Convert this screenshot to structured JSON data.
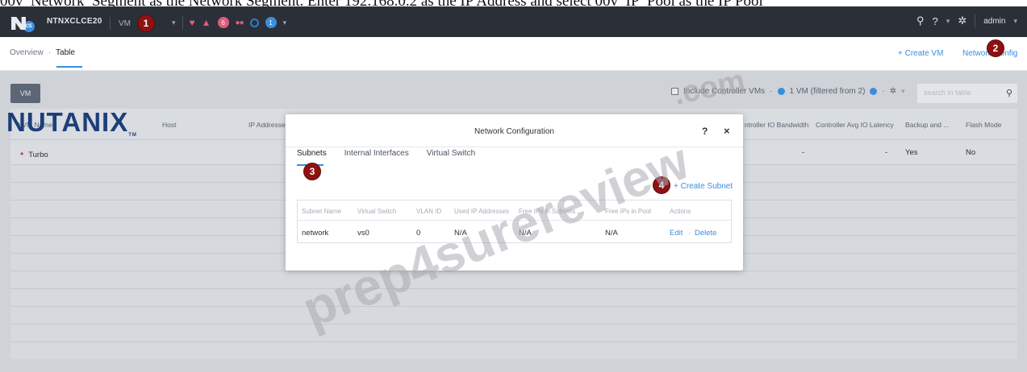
{
  "caption": "00v_Network_Segment as the Network Segment. Enter 192.168.0.2 as the IP Address and select 00v_IP_Pool as the IP Pool",
  "topbar": {
    "logo_badge": "CE",
    "cluster_name": "NTNXCLCE20",
    "menu_label": "VM",
    "callout_1": "1",
    "alert_count": "6",
    "task_count": "1",
    "user": "admin",
    "icons": [
      "heart-icon",
      "bell-icon",
      "ring-icon",
      "search-icon",
      "help-icon",
      "gear-icon"
    ]
  },
  "subbar": {
    "crumb_overview": "Overview",
    "crumb_sep": "·",
    "crumb_table": "Table",
    "create_vm": "+ Create VM",
    "network_config": "Network Config",
    "callout_2": "2"
  },
  "toolbar": {
    "vm_button": "VM",
    "include_cvms": "Include Controller VMs",
    "sep": "·",
    "filter_summary": "1 VM (filtered from 2)",
    "search_placeholder": "search in table"
  },
  "table": {
    "headers": [
      "^ VM Name",
      "Host",
      "IP Addresse",
      "ntroller IO Bandwidth",
      "Controller Avg IO Latency",
      "Backup and ...",
      "Flash Mode"
    ],
    "row": {
      "name": "Turbo",
      "io_latency": "-",
      "backup": "-",
      "backup_yes": "Yes",
      "flash": "No"
    }
  },
  "brand_logo": "NUTANIX",
  "modal": {
    "title": "Network Configuration",
    "help": "?",
    "close": "×",
    "tabs": [
      "Subnets",
      "Internal Interfaces",
      "Virtual Switch"
    ],
    "callout_3": "3",
    "callout_4": "4",
    "create_subnet": "+ Create Subnet",
    "columns": [
      "Subnet Name",
      "Virtual Switch",
      "VLAN ID",
      "Used IP Addresses",
      "Free IPs in Subnets",
      "Free IPs in Pool",
      "Actions"
    ],
    "row": {
      "name": "network",
      "switch": "vs0",
      "vlan": "0",
      "used": "N/A",
      "free_subnet": "N/A",
      "free_pool": "N/A",
      "edit": "Edit",
      "action_sep": "·",
      "delete": "Delete"
    }
  },
  "watermark": {
    "line1": ".com",
    "line2": "prep4surereview"
  },
  "colors": {
    "topbar": "#2b2f38",
    "accent": "#3a8dde",
    "callout": "#8e1212",
    "overlay": "#cfd2d7"
  }
}
